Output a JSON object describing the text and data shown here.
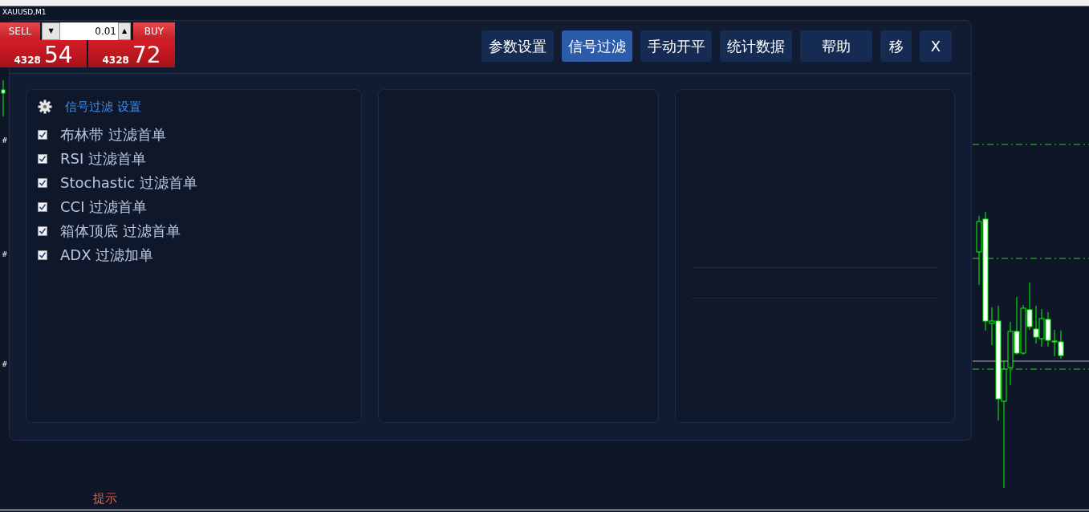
{
  "chart": {
    "title": "XAUUSD,M1",
    "left_marks": [
      "#",
      "#",
      "#"
    ],
    "hint": "提示"
  },
  "one_click": {
    "sell_label": "SELL",
    "buy_label": "BUY",
    "lot": "0.01",
    "down_arrow": "▼",
    "up_arrow": "▲",
    "bid_small": "4328",
    "bid_big": "54",
    "ask_small": "4328",
    "ask_big": "72"
  },
  "toolbar": [
    {
      "label": "参数设置",
      "selected": false
    },
    {
      "label": "信号过滤",
      "selected": true
    },
    {
      "label": "手动开平",
      "selected": false
    },
    {
      "label": "统计数据",
      "selected": false
    },
    {
      "label": "帮助",
      "selected": false
    },
    {
      "label": "移",
      "selected": false
    },
    {
      "label": "X",
      "selected": false
    }
  ],
  "filter_card": {
    "title": "信号过滤 设置",
    "items": [
      {
        "label": "布林带 过滤首单",
        "checked": true
      },
      {
        "label": "RSI 过滤首单",
        "checked": true
      },
      {
        "label": "Stochastic 过滤首单",
        "checked": true
      },
      {
        "label": "CCI 过滤首单",
        "checked": true
      },
      {
        "label": "箱体顶底 过滤首单",
        "checked": true
      },
      {
        "label": "ADX 过滤加单",
        "checked": true
      }
    ]
  }
}
